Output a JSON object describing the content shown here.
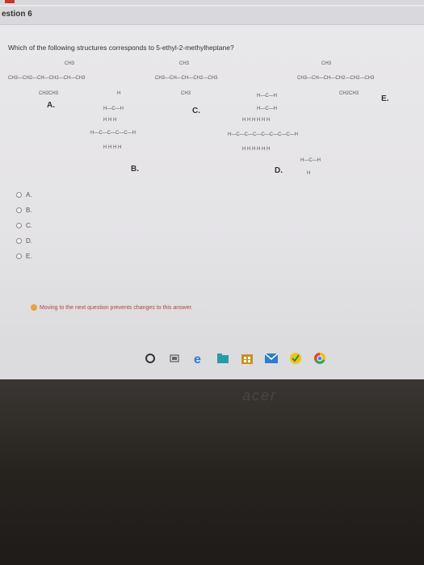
{
  "header": {
    "title": "estion 6"
  },
  "question": {
    "prompt": "Which of the following structures corresponds to 5-ethyl-2-methylheptane?"
  },
  "structures": {
    "A": {
      "letter": "A.",
      "top": "CH3",
      "main": "CH3—CH2—CH—CH2—CH—CH3",
      "bottom": "CH2CH3"
    },
    "B": {
      "letter": "B.",
      "row1": "H—C—H",
      "row2": "H    H    H",
      "row3": "H—C—C—C—C—H",
      "row4": "H    H    H    H"
    },
    "C": {
      "letter": "C.",
      "top": "CH3",
      "main": "CH3—CH—CH—CH2—CH3",
      "bottom": "CH3",
      "h": "H"
    },
    "D": {
      "letter": "D.",
      "row0": "H—C—H",
      "row1": "H—C—H",
      "row2": "H    H    H    H    H    H",
      "row3": "H—C—C—C—C—C—C—C—H",
      "row4": "H    H    H    H    H    H",
      "row5": "H—C—H",
      "row6": "H"
    },
    "E": {
      "letter": "E.",
      "top": "CH3",
      "main": "CH3—CH—CH—CH2—CH2—CH3",
      "bottom": "CH2CH3"
    }
  },
  "options": [
    {
      "label": "A."
    },
    {
      "label": "B."
    },
    {
      "label": "C."
    },
    {
      "label": "D."
    },
    {
      "label": "E."
    }
  ],
  "notice": "Moving to the next question prevents changes to this answer.",
  "taskbar": {
    "icons": [
      "cortana-icon",
      "task-view-icon",
      "edge-icon",
      "explorer-icon",
      "store-icon",
      "mail-icon",
      "norton-icon",
      "chrome-icon"
    ]
  },
  "colors": {
    "accent": "#2b7cd3",
    "warning": "#e6a23c",
    "bezel": "#26231f"
  },
  "brand": "acer"
}
